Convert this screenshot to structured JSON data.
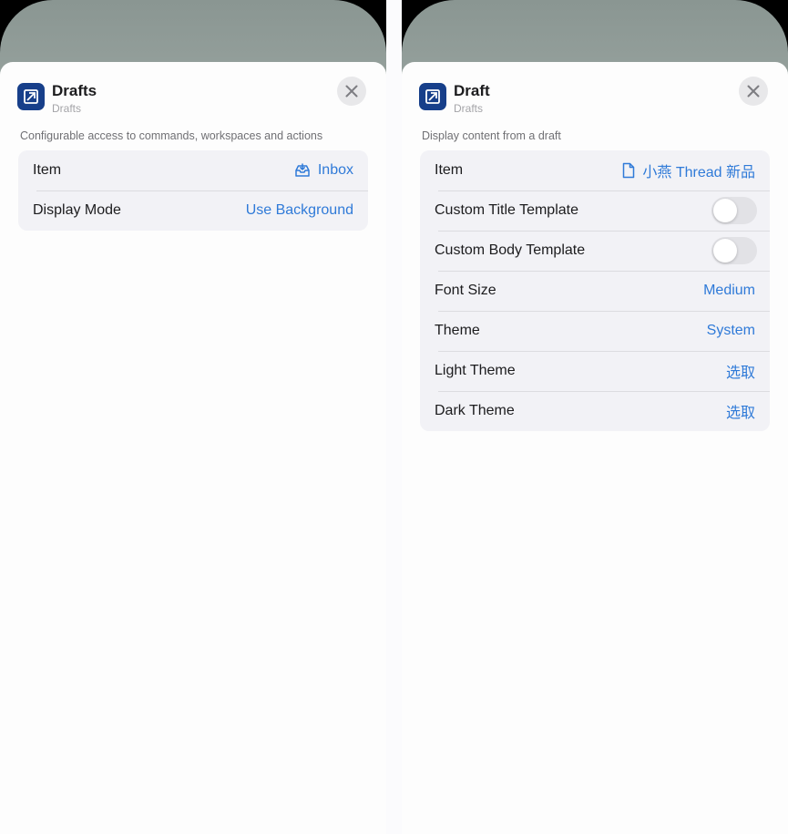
{
  "colors": {
    "accent": "#2f7ad8",
    "app_icon_bg": "#173f8a",
    "sheet_bg": "#fdfdfd",
    "group_bg": "#f2f2f6"
  },
  "left_panel": {
    "app": {
      "icon": "drafts-app-icon",
      "title": "Drafts",
      "subtitle": "Drafts"
    },
    "close_icon": "close-icon",
    "description": "Configurable access to commands, workspaces and actions",
    "rows": [
      {
        "label": "Item",
        "value": "Inbox",
        "value_icon": "inbox-tray-icon"
      },
      {
        "label": "Display Mode",
        "value": "Use Background"
      }
    ]
  },
  "right_panel": {
    "app": {
      "icon": "drafts-app-icon",
      "title": "Draft",
      "subtitle": "Drafts"
    },
    "close_icon": "close-icon",
    "description": "Display content from a draft",
    "rows": [
      {
        "label": "Item",
        "value": "小燕 Thread 新品",
        "value_icon": "document-icon"
      },
      {
        "label": "Custom Title Template",
        "toggle": false
      },
      {
        "label": "Custom Body Template",
        "toggle": false
      },
      {
        "label": "Font Size",
        "value": "Medium"
      },
      {
        "label": "Theme",
        "value": "System"
      },
      {
        "label": "Light Theme",
        "value": "选取"
      },
      {
        "label": "Dark Theme",
        "value": "选取"
      }
    ]
  }
}
